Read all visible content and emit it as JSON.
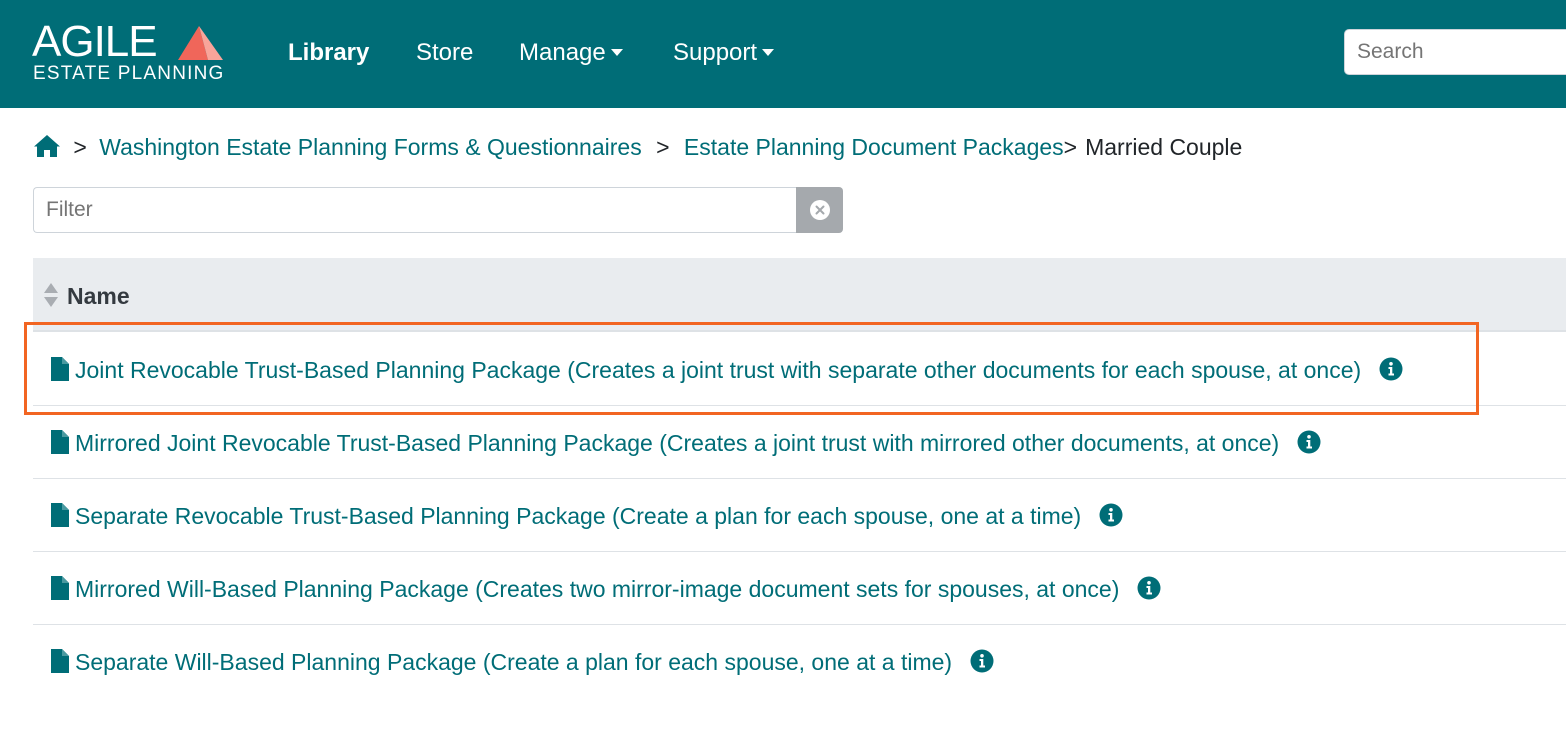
{
  "brand": {
    "name": "AGILE",
    "tagline": "ESTATE PLANNING",
    "colors": {
      "primary": "#006d77",
      "accent": "#f0665a",
      "accent_light": "#f9a49a",
      "highlight": "#f26522"
    }
  },
  "nav": {
    "items": [
      {
        "label": "Library",
        "active": true
      },
      {
        "label": "Store"
      },
      {
        "label": "Manage",
        "dropdown": true
      },
      {
        "label": "Support",
        "dropdown": true
      }
    ],
    "search_placeholder": "Search"
  },
  "breadcrumb": {
    "home_icon": "home-icon",
    "sep1": ">",
    "link1": "Washington Estate Planning Forms & Questionnaires",
    "sep2": ">",
    "link2": "Estate Planning Document Packages",
    "sep3": ">",
    "current": "Married Couple"
  },
  "filter": {
    "placeholder": "Filter",
    "clear_icon": "clear-icon"
  },
  "table": {
    "header": {
      "name": "Name",
      "sort_icon": "sort-icon"
    },
    "rows": [
      {
        "label": "Joint Revocable Trust-Based Planning Package (Creates a joint trust with separate other documents for each spouse, at once)",
        "highlighted": true
      },
      {
        "label": "Mirrored Joint Revocable Trust-Based Planning Package (Creates a joint trust with mirrored other documents, at once)"
      },
      {
        "label": "Separate Revocable Trust-Based Planning Package (Create a plan for each spouse, one at a time)"
      },
      {
        "label": "Mirrored Will-Based Planning Package (Creates two mirror-image document sets for spouses, at once)"
      },
      {
        "label": "Separate Will-Based Planning Package (Create a plan for each spouse, one at a time)"
      }
    ]
  }
}
